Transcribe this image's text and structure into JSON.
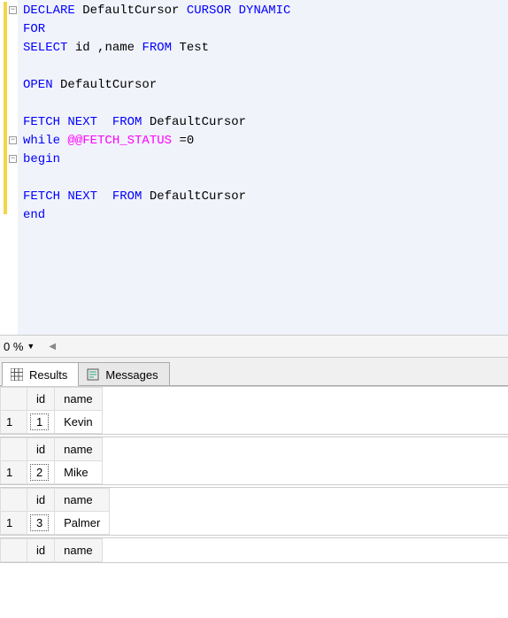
{
  "code": {
    "tokens": [
      [
        {
          "t": "DECLARE",
          "c": "kw"
        },
        {
          "t": " DefaultCursor ",
          "c": "txt"
        },
        {
          "t": "CURSOR DYNAMIC",
          "c": "kw"
        }
      ],
      [
        {
          "t": "FOR",
          "c": "kw"
        }
      ],
      [
        {
          "t": "SELECT",
          "c": "kw"
        },
        {
          "t": " id ",
          "c": "txt"
        },
        {
          "t": ",",
          "c": "txt"
        },
        {
          "t": "name ",
          "c": "txt"
        },
        {
          "t": "FROM",
          "c": "kw"
        },
        {
          "t": " Test",
          "c": "txt"
        }
      ],
      [],
      [
        {
          "t": "OPEN",
          "c": "kw"
        },
        {
          "t": " DefaultCursor",
          "c": "txt"
        }
      ],
      [],
      [
        {
          "t": "FETCH NEXT",
          "c": "kw"
        },
        {
          "t": "  ",
          "c": "txt"
        },
        {
          "t": "FROM",
          "c": "kw"
        },
        {
          "t": " DefaultCursor",
          "c": "txt"
        }
      ],
      [
        {
          "t": "while ",
          "c": "kw"
        },
        {
          "t": "@@FETCH_STATUS",
          "c": "var"
        },
        {
          "t": " =",
          "c": "txt"
        },
        {
          "t": "0",
          "c": "num"
        }
      ],
      [
        {
          "t": "begin",
          "c": "kw"
        }
      ],
      [],
      [
        {
          "t": "FETCH NEXT",
          "c": "kw"
        },
        {
          "t": "  ",
          "c": "txt"
        },
        {
          "t": "FROM",
          "c": "kw"
        },
        {
          "t": " DefaultCursor",
          "c": "txt"
        }
      ],
      [
        {
          "t": "end",
          "c": "kw"
        }
      ]
    ],
    "folds": [
      {
        "line": 0,
        "sym": "−"
      },
      {
        "line": 7,
        "sym": "−"
      },
      {
        "line": 8,
        "sym": "−"
      }
    ]
  },
  "zoom": {
    "value": "0 %"
  },
  "tabs": {
    "results": "Results",
    "messages": "Messages"
  },
  "results": [
    {
      "cols": [
        "id",
        "name"
      ],
      "rows": [
        [
          "1",
          "Kevin"
        ]
      ]
    },
    {
      "cols": [
        "id",
        "name"
      ],
      "rows": [
        [
          "2",
          "Mike"
        ]
      ]
    },
    {
      "cols": [
        "id",
        "name"
      ],
      "rows": [
        [
          "3",
          "Palmer"
        ]
      ]
    },
    {
      "cols": [
        "id",
        "name"
      ],
      "rows": []
    }
  ]
}
